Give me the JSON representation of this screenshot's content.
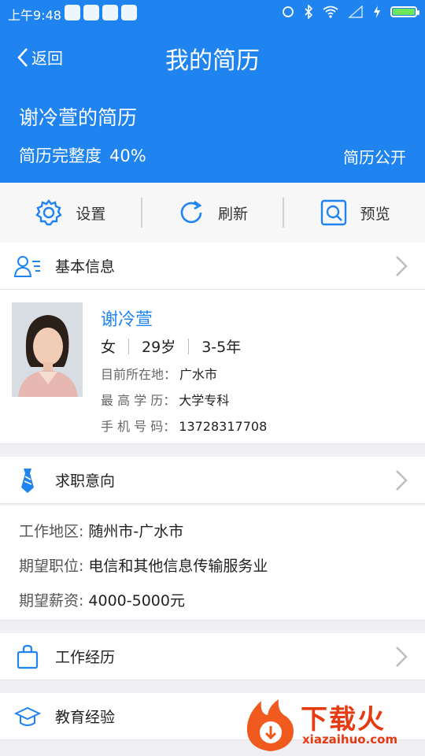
{
  "status_bar": {
    "time": "上午9:48",
    "icons": [
      "notification-icon",
      "app-icon",
      "wechat-icon",
      "message-icon",
      "alarm-icon",
      "bluetooth-icon",
      "wifi-icon",
      "signal-icon",
      "charging-icon",
      "battery-icon"
    ],
    "battery_level": 1.0
  },
  "header": {
    "back_label": "返回",
    "title": "我的简历",
    "resume_title": "谢冷萱的简历",
    "completeness_label": "简历完整度",
    "completeness_value": "40%",
    "public_label": "简历公开"
  },
  "toolbar": {
    "settings_label": "设置",
    "refresh_label": "刷新",
    "preview_label": "预览"
  },
  "basic_info": {
    "section_label": "基本信息",
    "name": "谢冷萱",
    "gender": "女",
    "age": "29岁",
    "experience": "3-5年",
    "location_label": "目前所在地：",
    "location": "广水市",
    "education_label": "最 高 学 历：",
    "education": "大学专科",
    "phone_label": "手 机 号 码：",
    "phone": "13728317708"
  },
  "job_intent": {
    "section_label": "求职意向",
    "area_label": "工作地区:",
    "area": "随州市-广水市",
    "position_label": "期望职位:",
    "position": "电信和其他信息传输服务业",
    "salary_label": "期望薪资:",
    "salary": "4000-5000元"
  },
  "work_exp": {
    "section_label": "工作经历"
  },
  "education_exp": {
    "section_label": "教育经验"
  },
  "watermark": {
    "text": "下载火",
    "url": "xiazaihuo.com"
  },
  "colors": {
    "primary": "#1f83f0",
    "watermark": "#e53a12"
  }
}
